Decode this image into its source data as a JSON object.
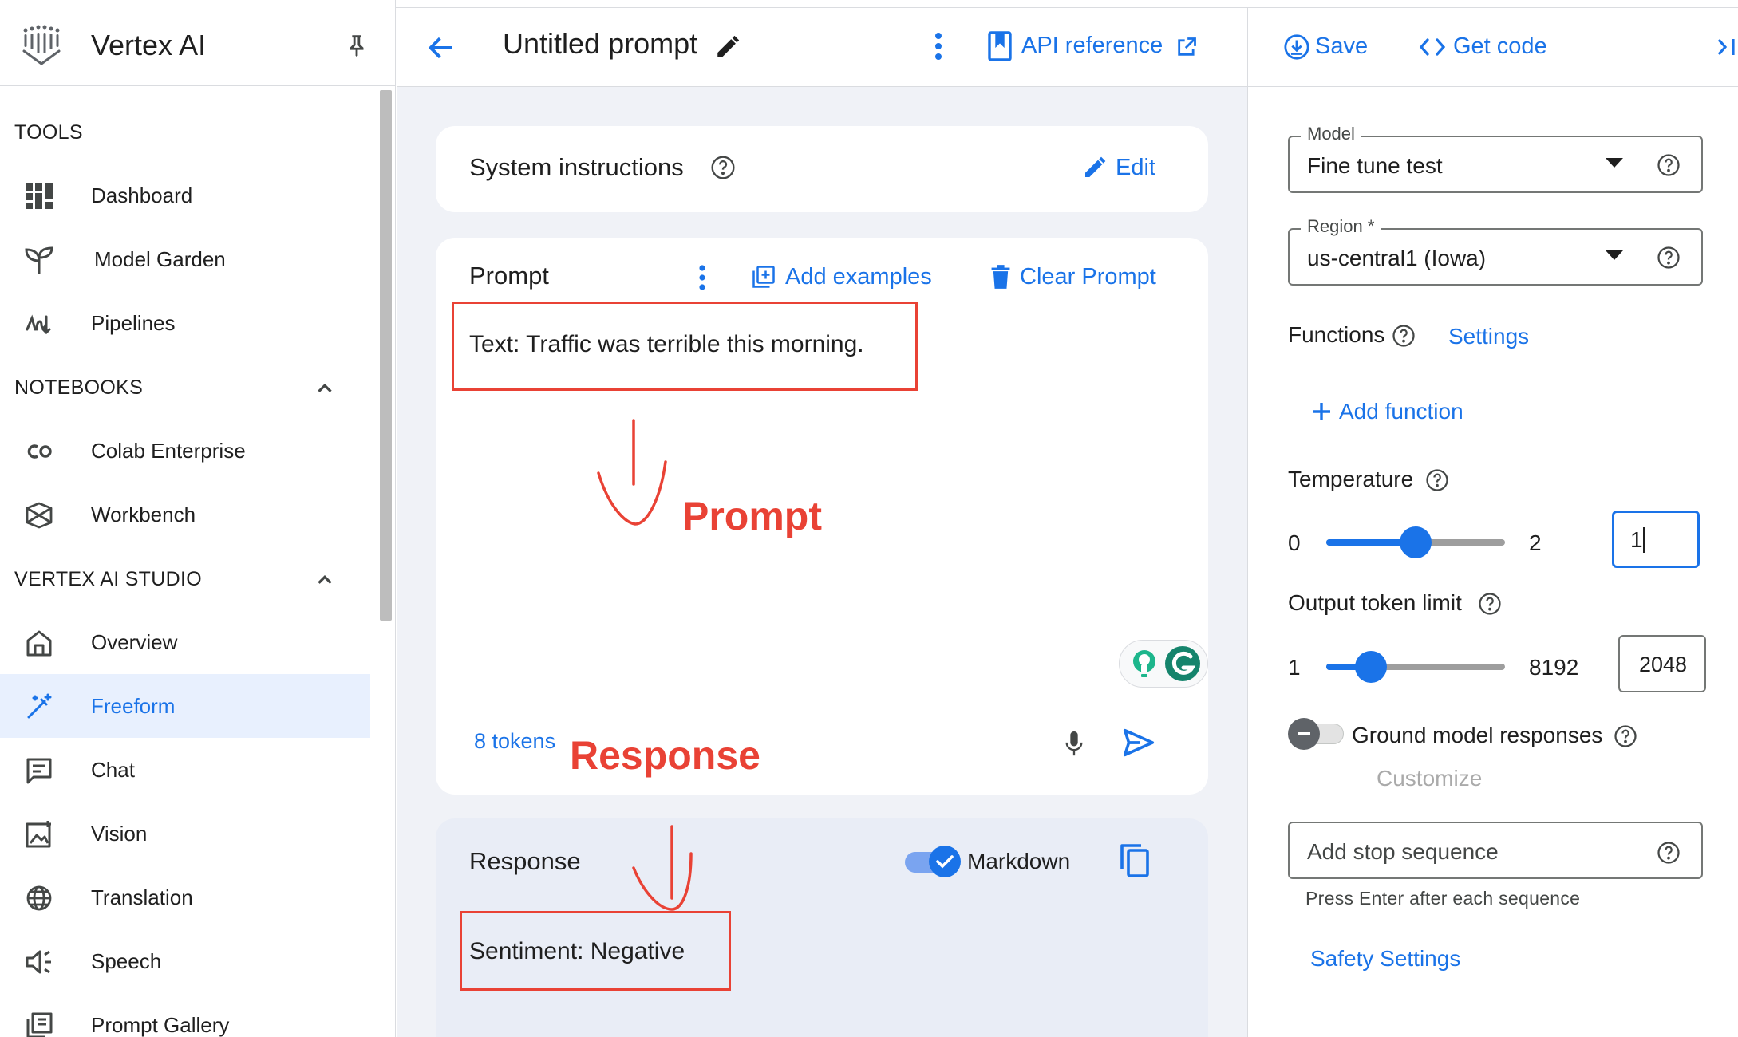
{
  "app": {
    "title": "Vertex AI"
  },
  "sidebar": {
    "sections": [
      {
        "title": "TOOLS"
      },
      {
        "title": "NOTEBOOKS"
      },
      {
        "title": "VERTEX AI STUDIO"
      }
    ],
    "items": [
      {
        "label": "Dashboard"
      },
      {
        "label": "Model Garden"
      },
      {
        "label": "Pipelines"
      },
      {
        "label": "Colab Enterprise"
      },
      {
        "label": "Workbench"
      },
      {
        "label": "Overview"
      },
      {
        "label": "Freeform"
      },
      {
        "label": "Chat"
      },
      {
        "label": "Vision"
      },
      {
        "label": "Translation"
      },
      {
        "label": "Speech"
      },
      {
        "label": "Prompt Gallery"
      }
    ],
    "active_item": "Freeform"
  },
  "header": {
    "prompt_title": "Untitled prompt",
    "api_reference": "API reference",
    "save": "Save",
    "get_code": "Get code"
  },
  "system_instructions": {
    "title": "System instructions",
    "edit": "Edit"
  },
  "prompt": {
    "title": "Prompt",
    "add_examples": "Add examples",
    "clear_prompt": "Clear Prompt",
    "text": "Text: Traffic was terrible this morning.",
    "tokens": "8 tokens"
  },
  "response": {
    "title": "Response",
    "markdown_label": "Markdown",
    "markdown_on": true,
    "text": "Sentiment: Negative"
  },
  "annotations": {
    "prompt_label": "Prompt",
    "response_label": "Response"
  },
  "settings": {
    "model": {
      "label": "Model",
      "value": "Fine tune test"
    },
    "region": {
      "label": "Region *",
      "value": "us-central1 (Iowa)"
    },
    "functions": {
      "label": "Functions",
      "settings_link": "Settings",
      "add_function": "Add function"
    },
    "temperature": {
      "label": "Temperature",
      "min": "0",
      "max": "2",
      "value": "1",
      "fraction": 0.5
    },
    "output_token_limit": {
      "label": "Output token limit",
      "min": "1",
      "max": "8192",
      "value": "2048",
      "fraction": 0.25
    },
    "grounding": {
      "label": "Ground model responses",
      "customize": "Customize",
      "enabled": false
    },
    "stop_sequence": {
      "placeholder": "Add stop sequence",
      "hint": "Press Enter after each sequence"
    },
    "safety_settings": "Safety Settings"
  },
  "colors": {
    "accent": "#1a73e8",
    "annotation": "#e94235",
    "active_bg": "#e8f0fe",
    "center_bg": "#f0f2f7"
  }
}
